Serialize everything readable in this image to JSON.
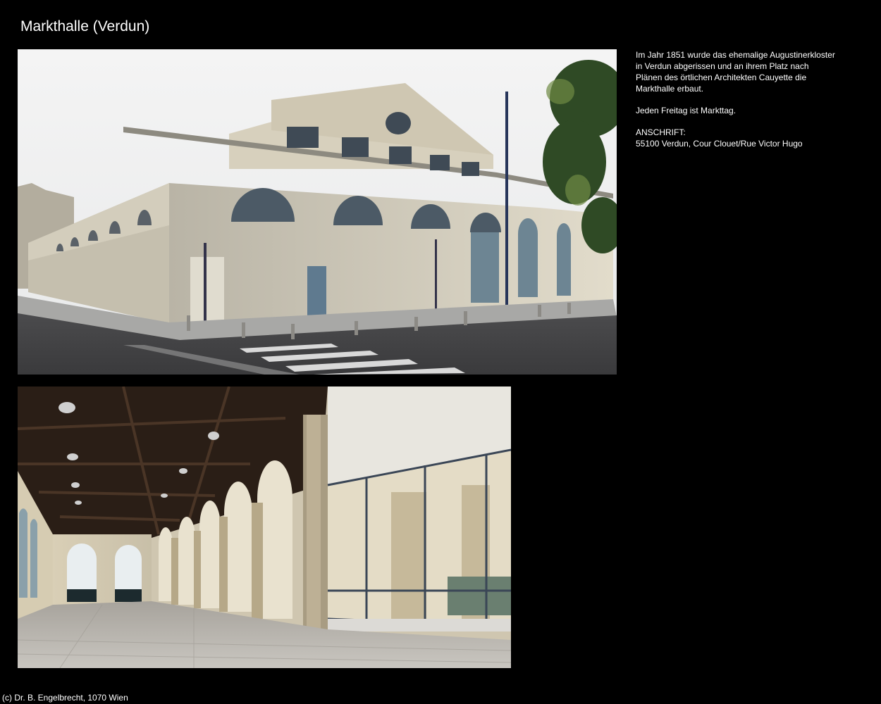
{
  "page": {
    "title": "Markthalle (Verdun)",
    "footer": "(c) Dr. B. Engelbrecht, 1070 Wien"
  },
  "description": {
    "paragraph1": [
      "Im Jahr 1851 wurde das ehemalige Augustinerkloster",
      "in Verdun abgerissen und an ihrem Platz nach",
      "Plänen des örtlichen Architekten Cauyette die",
      "Markthalle erbaut."
    ],
    "paragraph2": "Jeden Freitag ist Markttag.",
    "address_label": "ANSCHRIFT:",
    "address": "55100 Verdun, Cour Clouet/Rue Victor Hugo"
  }
}
